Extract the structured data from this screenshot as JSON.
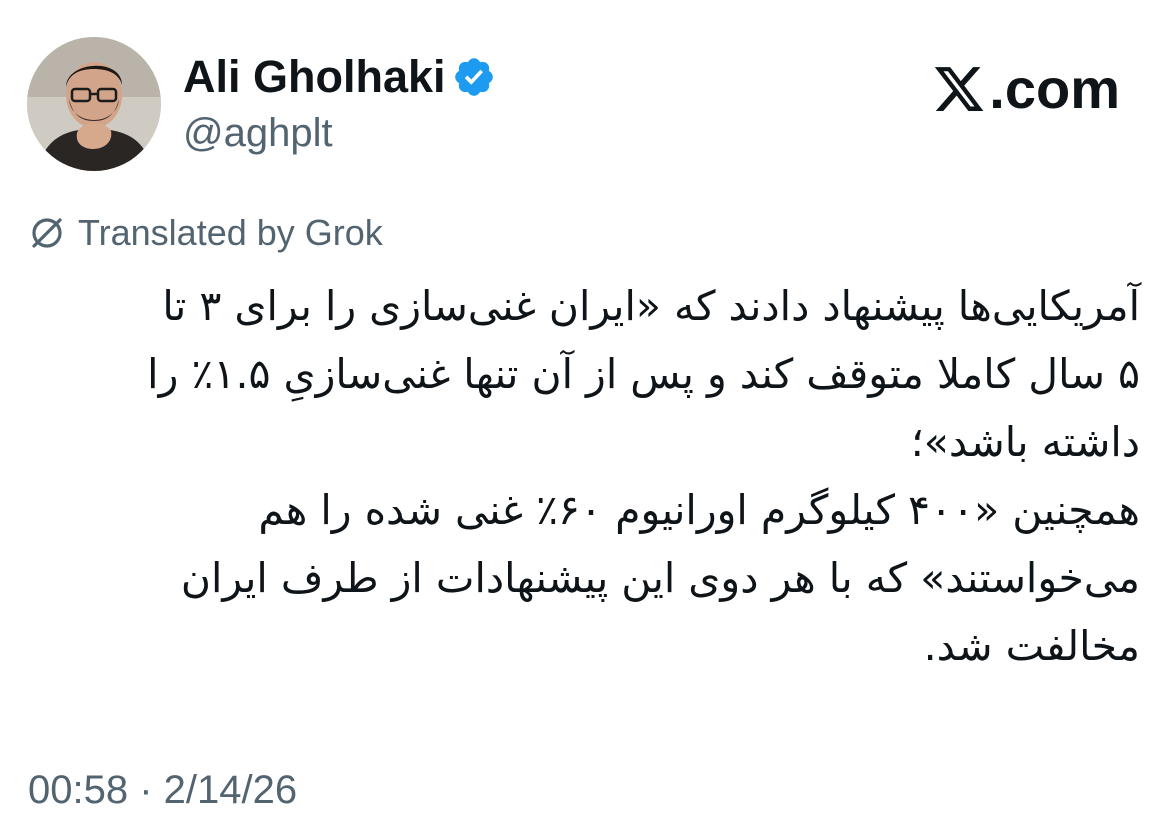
{
  "author": {
    "name": "Ali Gholhaki",
    "handle": "@aghplt",
    "verified_badge_icon": "verified-badge-icon",
    "avatar_icon": "profile-photo"
  },
  "brand": {
    "logo_icon": "x-logo-icon",
    "domain": ".com"
  },
  "translation": {
    "icon": "translate-icon",
    "label": "Translated by Grok"
  },
  "tweet": {
    "lines": [
      "آمریکایی‌ها پیشنهاد دادند که «ایران غنی‌سازی را برای ۳ تا",
      "۵ سال کاملا متوقف کند و پس از آن تنها غنی‌سازیِ ۱.۵٪ را",
      "داشته باشد»؛",
      "همچنین «۴۰۰ کیلوگرم اورانیوم ۶۰٪ غنی شده را هم",
      "می‌خواستند» که با هر دوی این پیشنهادات از طرف ایران",
      "مخالفت شد."
    ]
  },
  "timestamp": "00:58 · 2/14/26",
  "colors": {
    "text_primary": "#0f1419",
    "text_secondary": "#536471",
    "verified_blue": "#1d9bf0",
    "background": "#ffffff"
  }
}
